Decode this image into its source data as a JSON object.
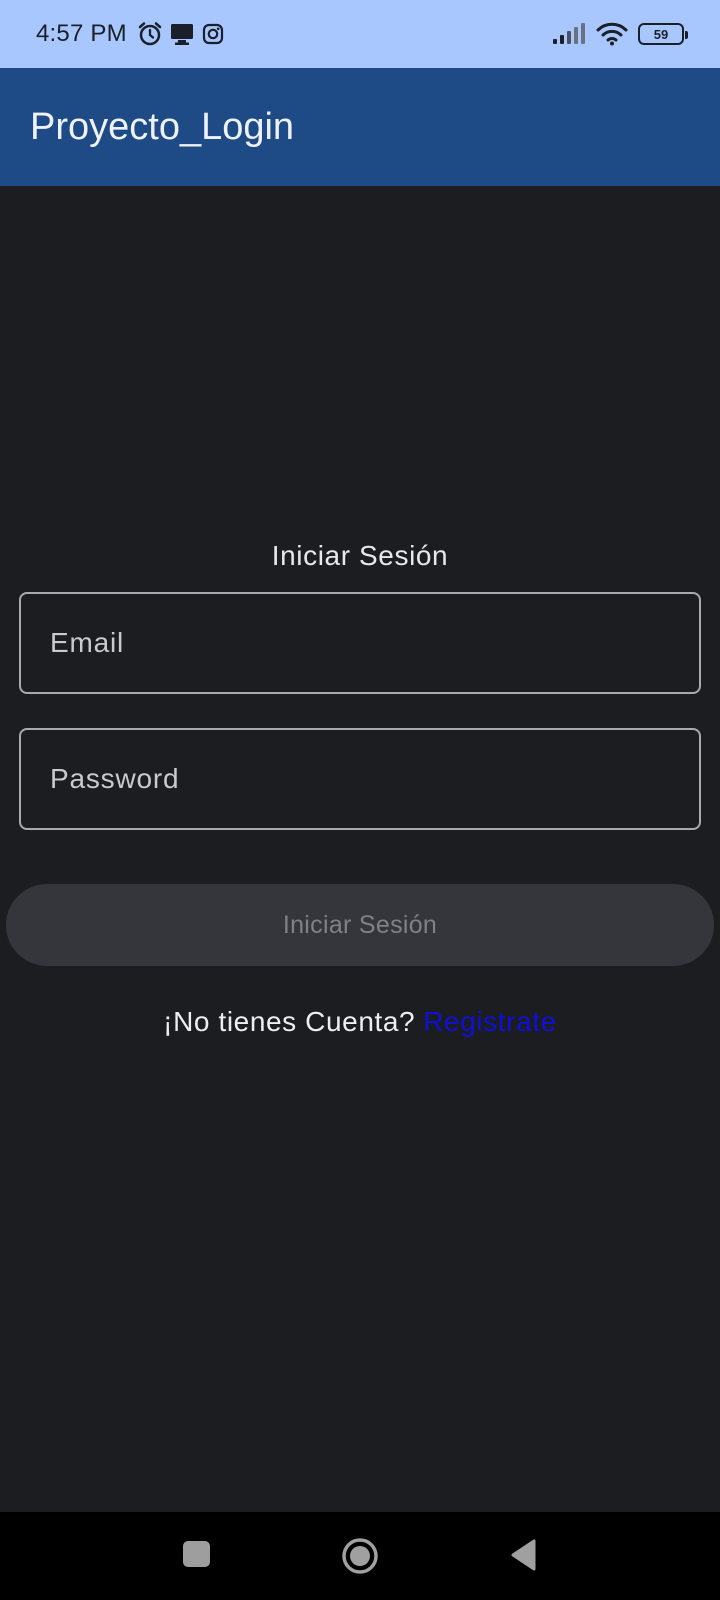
{
  "status_bar": {
    "time": "4:57 PM",
    "battery": "59",
    "icons": [
      "alarm-icon",
      "monitor-icon",
      "instagram-icon",
      "signal-icon",
      "wifi-icon",
      "battery-icon"
    ]
  },
  "app_bar": {
    "title": "Proyecto_Login"
  },
  "login": {
    "heading": "Iniciar Sesión",
    "email_placeholder": "Email",
    "password_placeholder": "Password",
    "button_label": "Iniciar Sesión",
    "no_account_text": "¡No tienes Cuenta?",
    "register_link": "Registrate"
  },
  "nav_bar": {
    "icons": [
      "recents-icon",
      "home-icon",
      "back-icon"
    ]
  },
  "colors": {
    "status_bar": "#a9c7ff",
    "app_bar": "#1e4a85",
    "background": "#1c1d21",
    "button": "#34363b",
    "link": "#0f0fd6"
  }
}
